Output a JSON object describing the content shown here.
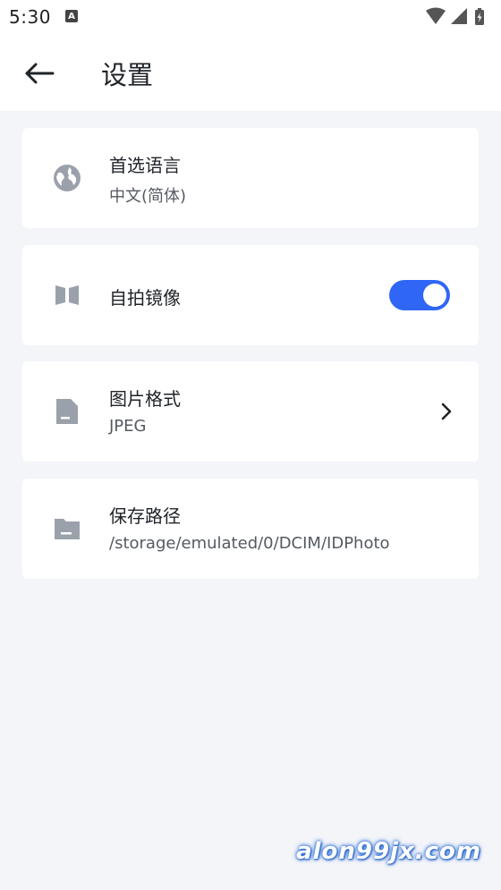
{
  "status_bar": {
    "time": "5:30",
    "notification_icon": "A"
  },
  "app_bar": {
    "title": "设置"
  },
  "settings": [
    {
      "icon": "globe-icon",
      "title": "首选语言",
      "subtitle": "中文(简体)"
    },
    {
      "icon": "mirror-icon",
      "title": "自拍镜像",
      "toggle": true
    },
    {
      "icon": "image-file-icon",
      "title": "图片格式",
      "subtitle": "JPEG",
      "chevron": true
    },
    {
      "icon": "folder-icon",
      "title": "保存路径",
      "subtitle": "/storage/emulated/0/DCIM/IDPhoto"
    }
  ],
  "watermark": "alon99jx.com",
  "colors": {
    "accent": "#2f66f6",
    "background": "#f4f5f9",
    "card": "#ffffff",
    "icon_gray": "#9aa1ab"
  }
}
